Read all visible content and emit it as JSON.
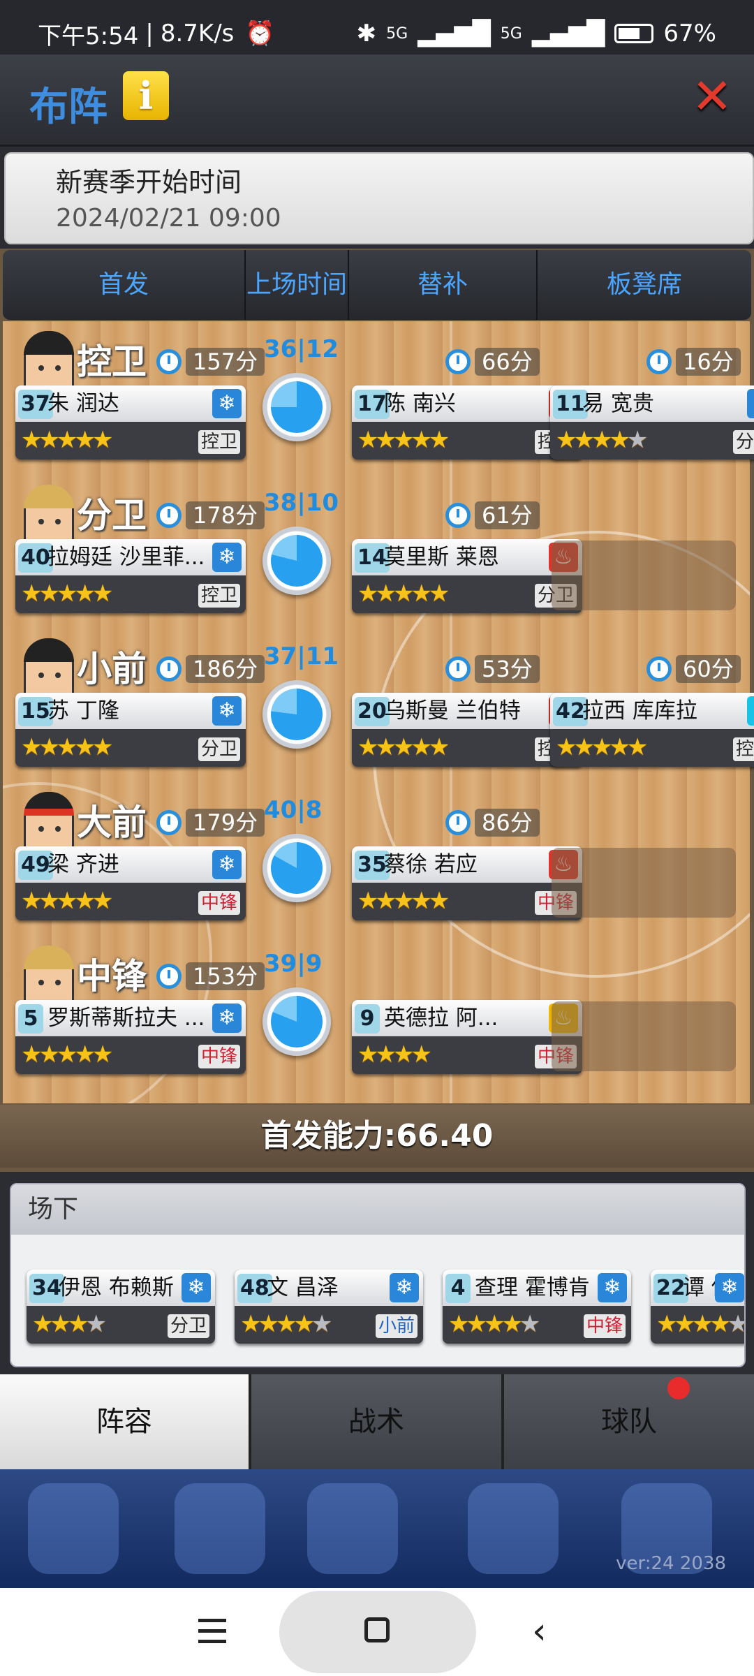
{
  "status": {
    "time": "下午5:54",
    "speed": "8.7K/s",
    "battery": "67%",
    "net1": "5G",
    "net2": "5G"
  },
  "title": "布阵",
  "season": {
    "label": "新赛季开始时间",
    "date": "2024/02/21 09:00"
  },
  "tabs": [
    "首发",
    "上场时间",
    "替补",
    "板凳席"
  ],
  "rows": [
    {
      "pos": "控卫",
      "starter_time": "157分",
      "split": [
        "36",
        "12"
      ],
      "pie": 0.75,
      "starter": {
        "num": "37",
        "name": "朱 润达",
        "badge": "snow",
        "stars": "★★★★",
        "half": "★",
        "role": "控卫",
        "role_color": ""
      },
      "sub1_time": "66分",
      "sub1": {
        "num": "17",
        "name": "陈 南兴",
        "badge": "fire",
        "stars": "★★★★",
        "half": "★",
        "role": "控卫",
        "role_color": ""
      },
      "sub2_time": "16分",
      "sub2": {
        "num": "11",
        "name": "易 宽贵",
        "badge": "snow",
        "stars": "★★★★",
        "half": "★",
        "role": "分卫",
        "role_color": "",
        "grey": true
      }
    },
    {
      "pos": "分卫",
      "starter_time": "178分",
      "split": [
        "38",
        "10"
      ],
      "pie": 0.79,
      "starter": {
        "num": "40",
        "name": "拉姆廷 沙里菲...",
        "badge": "snow",
        "stars": "★★★★",
        "half": "★",
        "role": "控卫",
        "role_color": ""
      },
      "sub1_time": "61分",
      "sub1": {
        "num": "14",
        "name": "莫里斯 莱恩",
        "badge": "fire",
        "stars": "★★★★",
        "half": "★",
        "role": "分卫",
        "role_color": ""
      }
    },
    {
      "pos": "小前",
      "starter_time": "186分",
      "split": [
        "37",
        "11"
      ],
      "pie": 0.77,
      "starter": {
        "num": "15",
        "name": "苏 丁隆",
        "badge": "snow",
        "stars": "★★★★",
        "half": "★",
        "role": "分卫",
        "role_color": ""
      },
      "sub1_time": "53分",
      "sub1": {
        "num": "20",
        "name": "乌斯曼 兰伯特",
        "badge": "fire",
        "stars": "★★★★",
        "half": "★",
        "role": "控卫",
        "role_color": ""
      },
      "sub2_time": "60分",
      "sub2": {
        "num": "42",
        "name": "拉西 库库拉",
        "badge": "snow2",
        "stars": "★★★★",
        "half": "★",
        "role": "控卫",
        "role_color": ""
      }
    },
    {
      "pos": "大前",
      "starter_time": "179分",
      "split": [
        "40",
        "8"
      ],
      "pie": 0.83,
      "starter": {
        "num": "49",
        "name": "梁 齐进",
        "badge": "snow",
        "stars": "★★★★",
        "half": "★",
        "role": "中锋",
        "role_color": "red"
      },
      "sub1_time": "86分",
      "sub1": {
        "num": "35",
        "name": "蔡徐 若应",
        "badge": "fire",
        "stars": "★★★★",
        "half": "★",
        "role": "中锋",
        "role_color": "red"
      }
    },
    {
      "pos": "中锋",
      "starter_time": "153分",
      "split": [
        "39",
        "9"
      ],
      "pie": 0.81,
      "starter": {
        "num": "5",
        "name": "罗斯蒂斯拉夫 ...",
        "badge": "snow",
        "stars": "★★★★",
        "half": "★",
        "role": "中锋",
        "role_color": "red"
      },
      "sub1": {
        "num": "9",
        "name": "英德拉 阿...",
        "badge": "gold",
        "stars": "★★★",
        "half": "★",
        "role": "中锋",
        "role_color": "red"
      }
    }
  ],
  "power": "首发能力:66.40",
  "bench": {
    "title": "场下",
    "players": [
      {
        "num": "34",
        "name": "伊恩 布赖斯",
        "badge": "snow",
        "stars": "★★★",
        "half": "★",
        "grey": true,
        "role": "分卫",
        "role_color": ""
      },
      {
        "num": "48",
        "name": "文 昌泽",
        "badge": "snow",
        "stars": "★★★★",
        "half": "★",
        "grey": true,
        "role": "小前",
        "role_color": "blue"
      },
      {
        "num": "4",
        "name": "查理 霍博肯",
        "badge": "snow",
        "stars": "★★★★",
        "half": "★",
        "grey": true,
        "role": "中锋",
        "role_color": "red"
      },
      {
        "num": "22",
        "name": "谭 传中",
        "badge": "snow",
        "stars": "★★★★",
        "half": "★",
        "grey": true,
        "role": "",
        "role_color": ""
      }
    ]
  },
  "bottom_tabs": [
    "阵容",
    "战术",
    "球队"
  ],
  "version": "ver:24  2038",
  "icons": {
    "info": "info-icon",
    "close": "close-icon",
    "timer": "stopwatch-icon",
    "snow": "snowflake-icon",
    "fire": "flame-icon"
  }
}
